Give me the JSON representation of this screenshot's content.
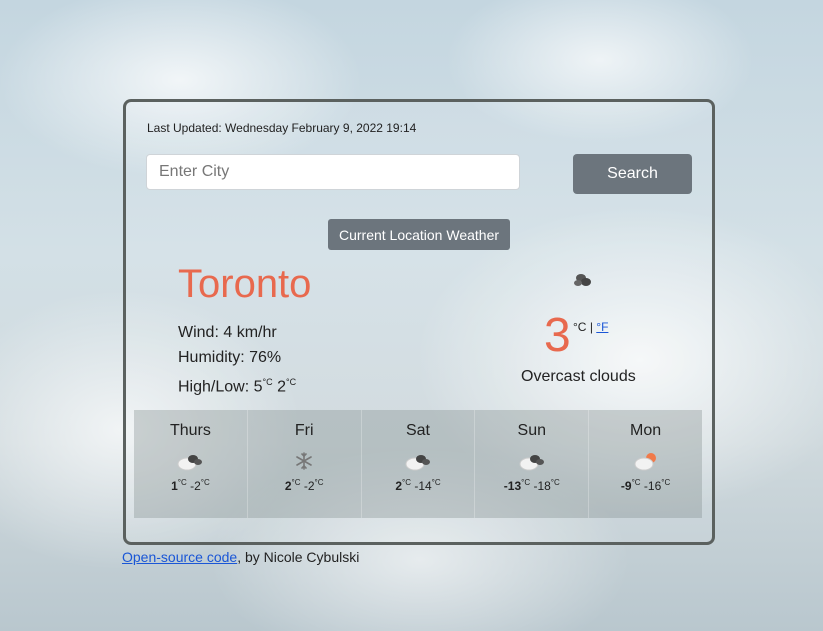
{
  "last_updated": "Last Updated: Wednesday February 9, 2022 19:14",
  "search": {
    "placeholder": "Enter City",
    "button_label": "Search"
  },
  "location_button_label": "Current Location Weather",
  "current": {
    "city": "Toronto",
    "wind": "Wind: 4 km/hr",
    "humidity": "Humidity: 76%",
    "highlow_label": "High/Low:",
    "high": "5",
    "low": "2",
    "temp": "3",
    "unit_c": "°C",
    "unit_sep": "|",
    "unit_f": "°F",
    "description": "Overcast clouds",
    "icon": "broken-clouds-icon"
  },
  "forecast": [
    {
      "day": "Thurs",
      "high": "1",
      "low": "-2",
      "icon": "broken-clouds-icon"
    },
    {
      "day": "Fri",
      "high": "2",
      "low": "-2",
      "icon": "snow-icon"
    },
    {
      "day": "Sat",
      "high": "2",
      "low": "-14",
      "icon": "broken-clouds-icon"
    },
    {
      "day": "Sun",
      "high": "-13",
      "low": "-18",
      "icon": "broken-clouds-icon"
    },
    {
      "day": "Mon",
      "high": "-9",
      "low": "-16",
      "icon": "few-clouds-icon"
    }
  ],
  "deg_c": "°C",
  "footer": {
    "link": "Open-source code",
    "text": ", by Nicole Cybulski"
  }
}
